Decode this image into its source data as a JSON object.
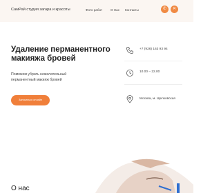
{
  "header": {
    "logo": "СамРай студия загара и красоты",
    "nav": [
      "Фото работ",
      "О Нас",
      "Контакты"
    ],
    "social": [
      {
        "name": "whatsapp-icon",
        "glyph": "✆"
      },
      {
        "name": "close-icon",
        "glyph": "✕"
      }
    ]
  },
  "hero": {
    "title": "Удаление перманентного макияжа бровей",
    "subtitle": "Поможем убрать нежелательный перманентный макияж бровей",
    "button": "Записаться онлайн"
  },
  "contacts": {
    "phone": "+7 (926) 163 93 94",
    "hours": "10.00 – 22.00",
    "address": "Москва, м. Щелковская"
  },
  "about": {
    "title": "О нас"
  },
  "colors": {
    "accent": "#f07f3a",
    "header_bg": "#fbf6f2"
  }
}
